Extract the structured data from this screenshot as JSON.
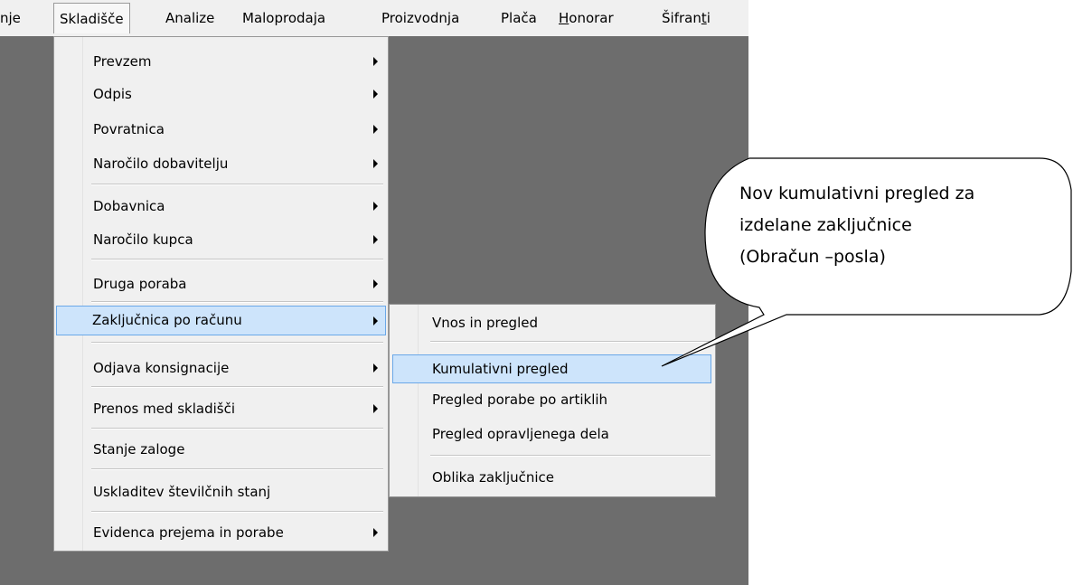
{
  "menubar": {
    "items": [
      {
        "label": "nje"
      },
      {
        "label": "Skladišče"
      },
      {
        "label": "Analize"
      },
      {
        "label": "Maloprodaja"
      },
      {
        "label": "Proizvodnja"
      },
      {
        "label": "Plača"
      },
      {
        "label": "Honorar",
        "mnemonic": "H",
        "rest": "onorar"
      },
      {
        "label": "Šifranti",
        "pre": "Šifran",
        "mnemonic": "t",
        "rest": "i"
      }
    ]
  },
  "skladisce_menu": {
    "items": [
      "Prevzem",
      "Odpis",
      "Povratnica",
      "Naročilo dobavitelju",
      "Dobavnica",
      "Naročilo kupca",
      "Druga poraba",
      "Zaključnica po računu",
      "Odjava konsignacije",
      "Prenos med skladišči",
      "Stanje zaloge",
      "Uskladitev številčnih stanj",
      "Evidenca prejema in porabe"
    ],
    "highlighted": "Zaključnica po računu"
  },
  "zakljucnica_submenu": {
    "items": [
      "Vnos in pregled",
      "Kumulativni pregled",
      "Pregled porabe po artiklih",
      "Pregled opravljenega dela",
      "Oblika zaključnice"
    ],
    "highlighted": "Kumulativni pregled"
  },
  "callout": {
    "text": "Nov kumulativni pregled za\nizdelane zaključnice\n(Obračun –posla)"
  },
  "colors": {
    "workspace": "#6d6d6d",
    "menu_background": "#f0f0f0",
    "highlight_fill": "#cde4fb",
    "highlight_border": "#6aa8e8"
  }
}
